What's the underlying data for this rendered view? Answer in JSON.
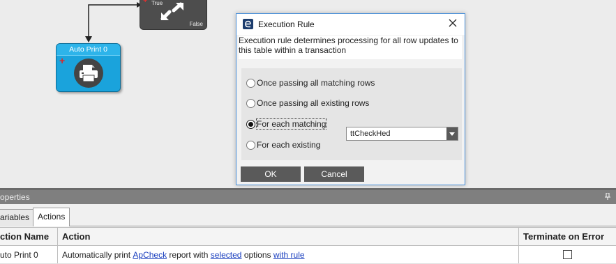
{
  "canvas": {
    "condition_node": {
      "true_label": "True",
      "false_label": "False"
    },
    "print_node": {
      "title": "Auto Print 0"
    }
  },
  "dialog": {
    "title": "Execution Rule",
    "description": "Execution rule determines processing for all row updates to this table within a transaction",
    "options": [
      {
        "label": "Once passing all matching rows",
        "checked": false
      },
      {
        "label": "Once passing all existing rows",
        "checked": false
      },
      {
        "label": "For each matching",
        "checked": true
      },
      {
        "label": "For each existing",
        "checked": false
      }
    ],
    "table_select": {
      "value": "ttCheckHed"
    },
    "ok_label": "OK",
    "cancel_label": "Cancel"
  },
  "properties": {
    "header": "operties",
    "tabs": [
      {
        "label": "ariables",
        "active": false
      },
      {
        "label": "Actions",
        "active": true
      }
    ],
    "columns": [
      "ction Name",
      "Action",
      "Terminate on Error"
    ],
    "rows": [
      {
        "name": "uto Print 0",
        "action_text_1": "Automatically print ",
        "action_link_1": "ApCheck",
        "action_text_2": " report with ",
        "action_link_2": "selected",
        "action_text_3": " options ",
        "action_link_3": "with rule",
        "terminate_on_error": false
      }
    ]
  }
}
